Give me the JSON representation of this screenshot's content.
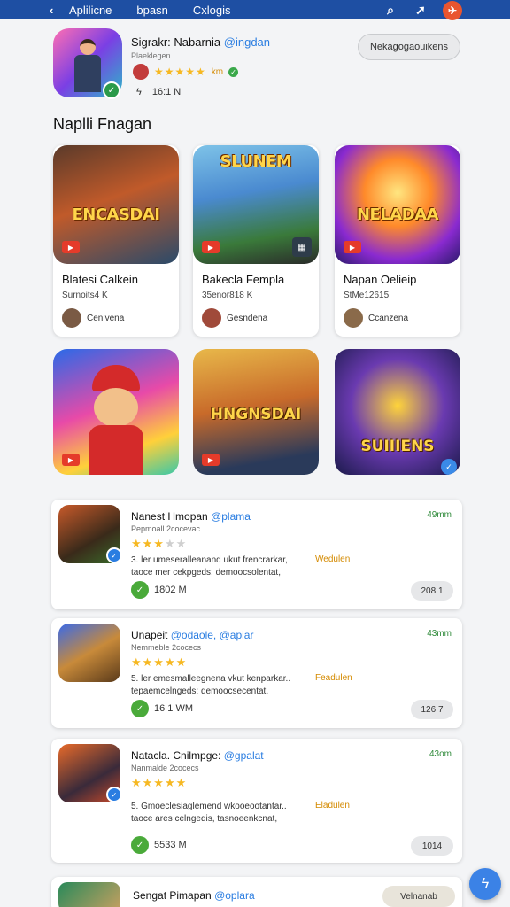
{
  "topbar": {
    "back_icon": "chevron-left-icon",
    "nav": [
      "Aplilicne",
      "bpasn",
      "Cxlogis"
    ],
    "icons": [
      "search-icon",
      "share-icon",
      "profile-icon"
    ]
  },
  "header": {
    "name": "Sigrakr: Nabarnia",
    "handle": "@ingdan",
    "subtitle": "Plaeklegen",
    "rating_tag": "km",
    "downloads_icon": "bolt-icon",
    "downloads": "16:1 N",
    "follow_label": "Nekagogaouikens"
  },
  "section_title": "Naplli Fnagan",
  "games": [
    {
      "art_title": "ENCASDAI",
      "title": "Blatesi Calkein",
      "meta": "Surnoits4 K",
      "dev": "Cenivena"
    },
    {
      "art_title": "SLUNEM",
      "title": "Bakecla Fempla",
      "meta": "35enor818 K",
      "dev": "Gesndena"
    },
    {
      "art_title": "NELADAA",
      "title": "Napan Oelieip",
      "meta": "StMe12615",
      "dev": "Ccanzena"
    }
  ],
  "tiles": [
    {
      "art_title": ""
    },
    {
      "art_title": "HNGNSDAI"
    },
    {
      "art_title": "SUIIIENS"
    }
  ],
  "list": [
    {
      "title": "Nanest Hmopan",
      "handle": "@plama",
      "sub": "Pepmoall 2cocevac",
      "stars": 3,
      "desc": "3. ler umeseralleanand ukut frencrarkar,",
      "desc2": "taoce mer cekpgeds; demoocsolentat,",
      "tag": "Wedulen",
      "time": "49mm",
      "downloads": "1802 M",
      "btn": "208 1"
    },
    {
      "title": "Unapeit",
      "handle": "@odaole, @apiar",
      "sub": "Nemmeble 2cocecs",
      "stars": 5,
      "desc": "5. ler emesmalleegnena vkut kenparkar..",
      "desc2": "tepaemcelngeds; demoocsecentat,",
      "tag": "Feadulen",
      "time": "43mm",
      "downloads": "16 1 WM",
      "btn": "126 7"
    },
    {
      "title": "Natacla. Cnilmpge:",
      "handle": "@gpalat",
      "sub": "Nanmalde 2cocecs",
      "stars": 5,
      "desc": "5. Gmoeclesiaglemend wkooeootantar..",
      "desc2": "taoce ares celngedis, tasnoeenkcnat,",
      "tag": "Eladulen",
      "time": "43om",
      "downloads": "5533 M",
      "btn": "1014"
    }
  ],
  "bottom": {
    "title": "Sengat Pimapan",
    "handle": "@oplara",
    "btn": "Velnanab"
  },
  "fab_icon": "bolt-icon"
}
